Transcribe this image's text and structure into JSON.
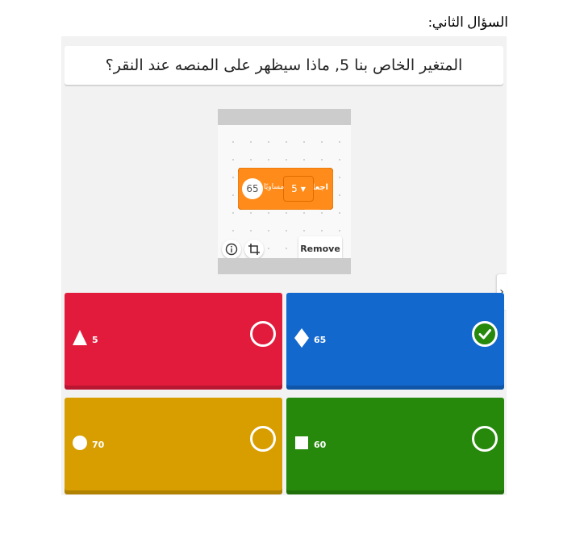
{
  "heading": "السؤال الثاني:",
  "question": "المتغير الخاص بنا 5, ماذا سيظهر على المنصه عند النقر؟",
  "media": {
    "block_label": "اجعل",
    "dropdown_value": "5",
    "dropdown_arrow": "▼",
    "equals_label": "مساويًا",
    "value": "65",
    "remove_label": "Remove"
  },
  "next_arrow": "›",
  "answers": [
    {
      "label": "5",
      "shape": "triangle-icon",
      "color": "#e21b3c",
      "correct": false
    },
    {
      "label": "65",
      "shape": "diamond-icon",
      "color": "#1368ce",
      "correct": true
    },
    {
      "label": "70",
      "shape": "circle-icon",
      "color": "#d89e00",
      "correct": false
    },
    {
      "label": "60",
      "shape": "square-icon",
      "color": "#26890c",
      "correct": false
    }
  ]
}
